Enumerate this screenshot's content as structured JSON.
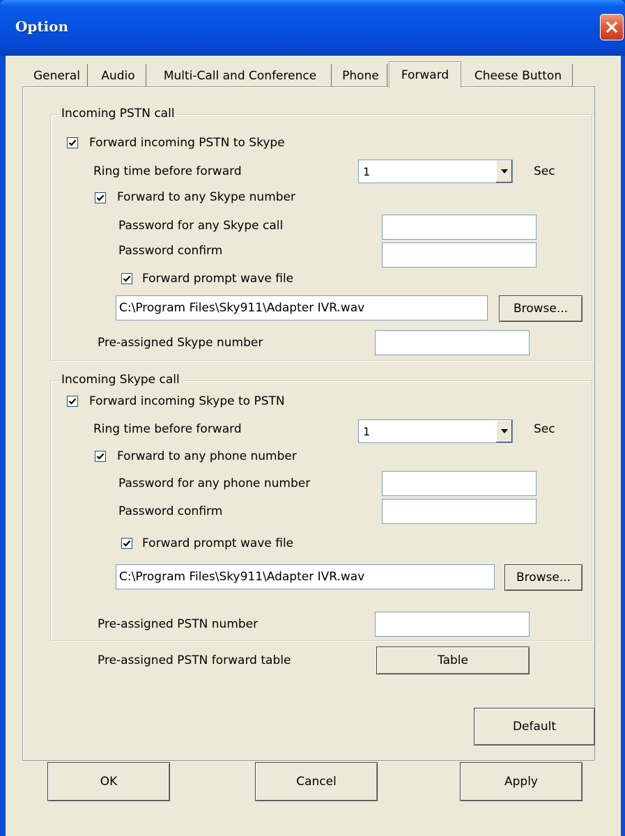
{
  "window": {
    "title": "Option",
    "close_icon": "close-icon"
  },
  "tabs": [
    {
      "label": "General"
    },
    {
      "label": "Audio"
    },
    {
      "label": "Multi-Call and Conference"
    },
    {
      "label": "Phone"
    },
    {
      "label": "Forward",
      "active": true
    },
    {
      "label": "Cheese Button"
    }
  ],
  "pstn": {
    "group_title": "Incoming PSTN call",
    "forward_label": "Forward incoming PSTN to Skype",
    "forward_checked": true,
    "ring_label": "Ring time before forward",
    "ring_value": "1",
    "ring_unit": "Sec",
    "any_label": "Forward to any Skype number",
    "any_checked": true,
    "password_label": "Password for any Skype call",
    "password_value": "",
    "confirm_label": "Password confirm",
    "confirm_value": "",
    "prompt_label": "Forward prompt wave file",
    "prompt_checked": true,
    "file_path": "C:\\Program Files\\Sky911\\Adapter IVR.wav",
    "browse_label": "Browse...",
    "preassigned_label": "Pre-assigned Skype number",
    "preassigned_value": ""
  },
  "skype": {
    "group_title": "Incoming Skype call",
    "forward_label": "Forward incoming Skype to PSTN",
    "forward_checked": true,
    "ring_label": "Ring time before forward",
    "ring_value": "1",
    "ring_unit": "Sec",
    "any_label": "Forward to any phone number",
    "any_checked": true,
    "password_label": "Password for any phone number",
    "password_value": "",
    "confirm_label": "Password confirm",
    "confirm_value": "",
    "prompt_label": "Forward prompt wave file",
    "prompt_checked": true,
    "file_path": "C:\\Program Files\\Sky911\\Adapter IVR.wav",
    "browse_label": "Browse...",
    "preassigned_label": "Pre-assigned PSTN number",
    "preassigned_value": "",
    "table_label": "Pre-assigned PSTN forward table",
    "table_button": "Table"
  },
  "default_button": "Default",
  "footer": {
    "ok": "OK",
    "cancel": "Cancel",
    "apply": "Apply"
  },
  "colors": {
    "titlebar": "#0551e0",
    "face": "#ece9d8",
    "close": "#e25c3a"
  }
}
